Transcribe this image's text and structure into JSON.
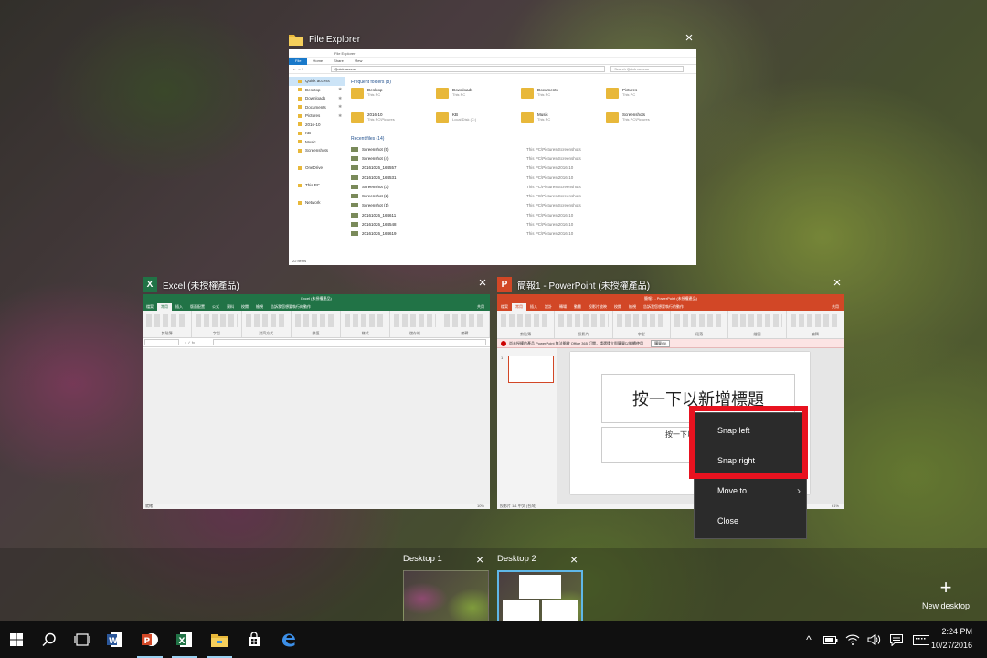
{
  "windows": {
    "file_explorer": {
      "title": "File Explorer",
      "inner_title": "File Explorer",
      "ribbon_tabs": [
        "File",
        "Home",
        "Share",
        "View"
      ],
      "address": "Quick access",
      "search_placeholder": "Search Quick access",
      "nav": [
        {
          "label": "Quick access",
          "pinned": false
        },
        {
          "label": "Desktop",
          "pinned": true
        },
        {
          "label": "Downloads",
          "pinned": true
        },
        {
          "label": "Documents",
          "pinned": true
        },
        {
          "label": "Pictures",
          "pinned": true
        },
        {
          "label": "2016-10",
          "pinned": false
        },
        {
          "label": "KB",
          "pinned": false
        },
        {
          "label": "Music",
          "pinned": false
        },
        {
          "label": "Screenshots",
          "pinned": false
        },
        {
          "label": "",
          "pinned": false
        },
        {
          "label": "OneDrive",
          "pinned": false
        },
        {
          "label": "",
          "pinned": false
        },
        {
          "label": "This PC",
          "pinned": false
        },
        {
          "label": "",
          "pinned": false
        },
        {
          "label": "Network",
          "pinned": false
        }
      ],
      "frequent_header": "Frequent folders (8)",
      "frequent": [
        {
          "name": "Desktop",
          "loc": "This PC"
        },
        {
          "name": "Downloads",
          "loc": "This PC"
        },
        {
          "name": "Documents",
          "loc": "This PC"
        },
        {
          "name": "Pictures",
          "loc": "This PC"
        },
        {
          "name": "2016-10",
          "loc": "This PC\\Pictures"
        },
        {
          "name": "KB",
          "loc": "Local Disk (C:)"
        },
        {
          "name": "Music",
          "loc": "This PC"
        },
        {
          "name": "Screenshots",
          "loc": "This PC\\Pictures"
        }
      ],
      "recent_header": "Recent files (14)",
      "recent": [
        {
          "name": "Screenshot (5)",
          "path": "This PC\\Pictures\\Screenshots"
        },
        {
          "name": "Screenshot (4)",
          "path": "This PC\\Pictures\\Screenshots"
        },
        {
          "name": "20161026_164557",
          "path": "This PC\\Pictures\\2016-10"
        },
        {
          "name": "20161026_164531",
          "path": "This PC\\Pictures\\2016-10"
        },
        {
          "name": "Screenshot (3)",
          "path": "This PC\\Pictures\\Screenshots"
        },
        {
          "name": "Screenshot (2)",
          "path": "This PC\\Pictures\\Screenshots"
        },
        {
          "name": "Screenshot (1)",
          "path": "This PC\\Pictures\\Screenshots"
        },
        {
          "name": "20161026_164611",
          "path": "This PC\\Pictures\\2016-10"
        },
        {
          "name": "20161026_164548",
          "path": "This PC\\Pictures\\2016-10"
        },
        {
          "name": "20161026_164619",
          "path": "This PC\\Pictures\\2016-10"
        }
      ],
      "status": "22 items"
    },
    "excel": {
      "title": "Excel (未授權產品)",
      "inner_title": "Excel (未授權產品)",
      "tabs": [
        "檔案",
        "常用",
        "插入",
        "版面配置",
        "公式",
        "資料",
        "校閱",
        "檢視",
        "告訴我您想要執行的動作"
      ],
      "share": "共用",
      "groups": [
        "剪貼簿",
        "字型",
        "對齊方式",
        "數值",
        "樣式",
        "儲存格",
        "編輯"
      ],
      "status_left": "就緒",
      "zoom": "10%"
    },
    "powerpoint": {
      "title": "簡報1 - PowerPoint (未授權產品)",
      "inner_title": "簡報1 - PowerPoint (未授權產品)",
      "tabs": [
        "檔案",
        "常用",
        "插入",
        "設計",
        "轉場",
        "動畫",
        "投影片放映",
        "校閱",
        "檢視",
        "告訴我您想要執行的動作"
      ],
      "share": "共用",
      "groups": [
        "剪貼簿",
        "投影片",
        "字型",
        "段落",
        "繪圖",
        "編輯"
      ],
      "warning": "尚未授權的產品 PowerPoint 無法開啟 Office 365 訂閱，請選擇立即購買以繼續使用",
      "warning_button": "購買(B)",
      "slide_number": "1",
      "slide_title": "按一下以新增標題",
      "slide_subtitle": "按一下以新增副標題",
      "status_left": "投影片 1/1   中文 (台灣)",
      "zoom": "61%"
    }
  },
  "context_menu": {
    "items": [
      "Snap left",
      "Snap right",
      "Move to",
      "Close"
    ]
  },
  "desktops": [
    {
      "label": "Desktop 1",
      "active": false
    },
    {
      "label": "Desktop 2",
      "active": true
    }
  ],
  "new_desktop": "New desktop",
  "clock": {
    "time": "2:24 PM",
    "date": "10/27/2016"
  },
  "colors": {
    "excel": "#217346",
    "powerpoint": "#d24726",
    "word": "#2b579a",
    "highlight": "#e8121f",
    "accent": "#5fb7e8"
  }
}
